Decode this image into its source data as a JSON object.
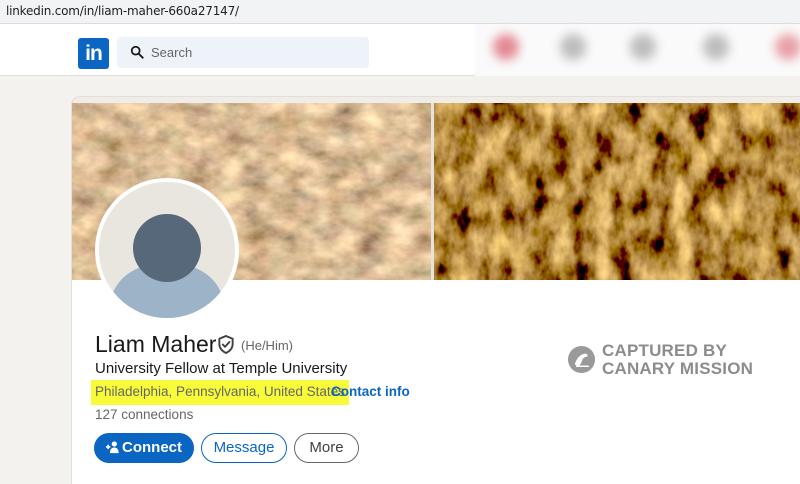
{
  "browser": {
    "url": "linkedin.com/in/liam-maher-660a27147/"
  },
  "navbar": {
    "logo_text": "in",
    "search_placeholder": "Search"
  },
  "profile": {
    "name": "Liam Maher",
    "pronouns": "(He/Him)",
    "headline": "University Fellow at Temple University",
    "location": "Philadelphia, Pennsylvania, United States",
    "separator": "·",
    "contact_info": "Contact info",
    "connections": "127 connections",
    "highlight_color": "#f8fb3a"
  },
  "actions": {
    "connect": "Connect",
    "message": "Message",
    "more": "More"
  },
  "watermark": {
    "line1": "CAPTURED BY",
    "line2": "CANARY MISSION"
  },
  "colors": {
    "brand": "#0a66c2",
    "background": "#f4f2ee",
    "card": "#ffffff"
  },
  "icons": [
    "search-icon",
    "verified-shield-icon",
    "add-person-icon",
    "canary-mission-logo"
  ]
}
